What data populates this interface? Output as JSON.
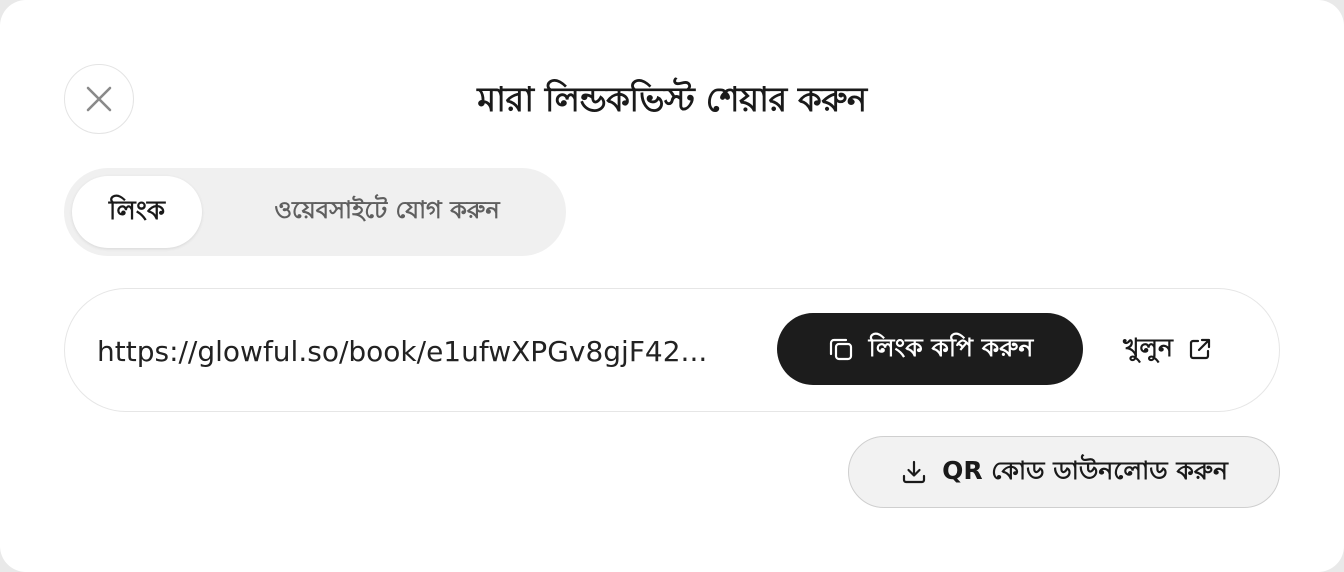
{
  "dialog": {
    "title": "মারা লিন্ডকভিস্ট শেয়ার করুন",
    "close_icon": "close-icon"
  },
  "tabs": [
    {
      "label": "লিংক",
      "selected": true
    },
    {
      "label": "ওয়েবসাইটে যোগ করুন",
      "selected": false
    }
  ],
  "share": {
    "url": "https://glowful.so/book/e1ufwXPGv8gjF42...",
    "copy_label": "লিংক কপি করুন",
    "copy_icon": "copy-icon",
    "open_label": "খুলুন",
    "open_icon": "external-link-icon"
  },
  "qr": {
    "label": "QR কোড ডাউনলোড করুন",
    "icon": "download-icon"
  },
  "colors": {
    "primary_button": "#1c1c1c",
    "background": "#ffffff",
    "tab_track": "#f0f0f0"
  }
}
